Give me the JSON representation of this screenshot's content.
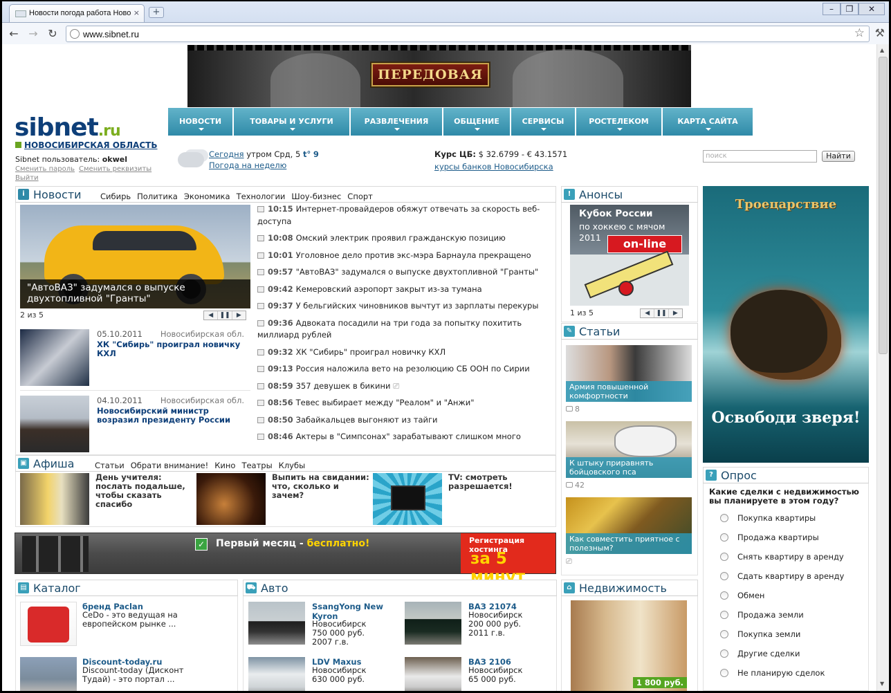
{
  "browser": {
    "tab_title": "Новости погода работа Ново",
    "tab_close": "×",
    "new_tab": "+",
    "min": "–",
    "max": "❐",
    "close": "✕",
    "back": "←",
    "forward": "→",
    "reload": "↻",
    "url": "www.sibnet.ru",
    "star": "☆",
    "wrench": "⚒"
  },
  "banner": {
    "title": "ПЕРЕДОВАЯ"
  },
  "logo": {
    "main": "sibnet",
    "tld": ".ru"
  },
  "region": "НОВОСИБИРСКАЯ ОБЛАСТЬ",
  "user": {
    "label": "Sibnet пользователь: ",
    "name": "okwel",
    "links": [
      "Сменить пароль",
      "Сменить реквизиты",
      "Выйти"
    ]
  },
  "nav": [
    "НОВОСТИ",
    "ТОВАРЫ И УСЛУГИ",
    "РАЗВЛЕЧЕНИЯ",
    "ОБЩЕНИЕ",
    "СЕРВИСЫ",
    "РОСТЕЛЕКОМ",
    "КАРТА САЙТА"
  ],
  "weather": {
    "today_link": "Сегодня",
    "today_rest": " утром Срд, 5 ",
    "t_label": "t°",
    "t_value": "9",
    "week_link": "Погода на неделю"
  },
  "currency": {
    "label": "Курс ЦБ:",
    "value": " $ 32.6799 - € 43.1571",
    "banks_link": "курсы банков Новосибирска"
  },
  "search": {
    "placeholder": "поиск",
    "button": "Найти"
  },
  "news": {
    "title": "Новости",
    "subs": [
      "Сибирь",
      "Политика",
      "Экономика",
      "Технологии",
      "Шоу-бизнес",
      "Спорт"
    ],
    "main_caption": "\"АвтоВАЗ\" задумался о выпуске двухтопливной \"Гранты\"",
    "main_counter": "2 из 5",
    "pager": [
      "◀",
      "❚❚",
      "▶"
    ],
    "items": [
      {
        "date": "05.10.2011",
        "region": "Новосибирская обл.",
        "headline": "ХК \"Сибирь\" проиграл новичку КХЛ"
      },
      {
        "date": "04.10.2011",
        "region": "Новосибирская обл.",
        "headline": "Новосибирский министр возразил президенту России"
      }
    ],
    "feed": [
      {
        "time": "10:15",
        "text": "Интернет-провайдеров обяжут отвечать за скорость веб-доступа"
      },
      {
        "time": "10:08",
        "text": "Омский электрик проявил гражданскую позицию"
      },
      {
        "time": "10:01",
        "text": "Уголовное дело против экс-мэра Барнаула прекращено"
      },
      {
        "time": "09:57",
        "text": "\"АвтоВАЗ\" задумался о выпуске двухтопливной \"Гранты\""
      },
      {
        "time": "09:42",
        "text": "Кемеровский аэропорт закрыт из-за тумана"
      },
      {
        "time": "09:37",
        "text": "У бельгийских чиновников вычтут из зарплаты перекуры"
      },
      {
        "time": "09:36",
        "text": "Адвоката посадили на три года за попытку похитить миллиард рублей"
      },
      {
        "time": "09:32",
        "text": "ХК \"Сибирь\" проиграл новичку КХЛ"
      },
      {
        "time": "09:13",
        "text": "Россия наложила вето на резолюцию СБ ООН по Сирии"
      },
      {
        "time": "08:59",
        "text": "357 девушек в бикини"
      },
      {
        "time": "08:56",
        "text": "Тевес выбирает между \"Реалом\" и \"Анжи\""
      },
      {
        "time": "08:50",
        "text": "Забайкальцев выгоняют из тайги"
      },
      {
        "time": "08:46",
        "text": "Актеры в \"Симпсонах\" зарабатывают слишком много"
      }
    ]
  },
  "afisha": {
    "title": "Афиша",
    "subs": [
      "Статьи",
      "Обрати внимание!",
      "Кино",
      "Театры",
      "Клубы"
    ],
    "items": [
      "День учителя: послать подальше, чтобы сказать спасибо",
      "Выпить на свидании: что, сколько и зачем?",
      "TV: смотреть разрешается!"
    ]
  },
  "hosting": {
    "text1": "Первый месяц - ",
    "text2": "бесплатно!",
    "reg1": "Регистрация хостинга",
    "reg2": "за 5 минут"
  },
  "anons": {
    "title": "Анонсы",
    "img_t1": "Кубок России",
    "img_t2": "по хоккею с мячом",
    "img_t3": "2011",
    "online": "on-line",
    "counter": "1 из 5"
  },
  "articles": {
    "title": "Статьи",
    "items": [
      {
        "caption": "Армия повышенной комфортности",
        "comments": "8"
      },
      {
        "caption": "К штыку приравнять бойцовского пса",
        "comments": "42"
      },
      {
        "caption": "Как совместить приятное с полезным?",
        "comments": ""
      }
    ]
  },
  "bigad": {
    "head": "Троецарствие",
    "text": "Освободи зверя!"
  },
  "poll": {
    "title": "Опрос",
    "question": "Какие сделки с недвижимостью вы планируете в этом году?",
    "options": [
      "Покупка квартиры",
      "Продажа квартиры",
      "Снять квартиру в аренду",
      "Сдать квартиру в аренду",
      "Обмен",
      "Продажа земли",
      "Покупка земли",
      "Другие сделки",
      "Не планирую сделок"
    ]
  },
  "catalog": {
    "title": "Каталог",
    "items": [
      {
        "title": "бренд Paclan",
        "desc": "CeDo - это ведущая на европейском рынке ..."
      },
      {
        "title": "Discount-today.ru",
        "desc": "Discount-today (Дисконт Тудай) - это портал ..."
      }
    ]
  },
  "auto": {
    "title": "Авто",
    "items": [
      {
        "title": "SsangYong New Kyron",
        "city": "Новосибирск",
        "price": "750 000 руб.",
        "year": "2007 г.в."
      },
      {
        "title": "ВАЗ 21074",
        "city": "Новосибирск",
        "price": "200 000 руб.",
        "year": "2011 г.в."
      },
      {
        "title": "LDV Maxus",
        "city": "Новосибирск",
        "price": "630 000 руб.",
        "year": ""
      },
      {
        "title": "ВАЗ 2106",
        "city": "Новосибирск",
        "price": "65 000 руб.",
        "year": ""
      }
    ]
  },
  "realty": {
    "title": "Недвижимость",
    "price": "1 800 руб."
  }
}
